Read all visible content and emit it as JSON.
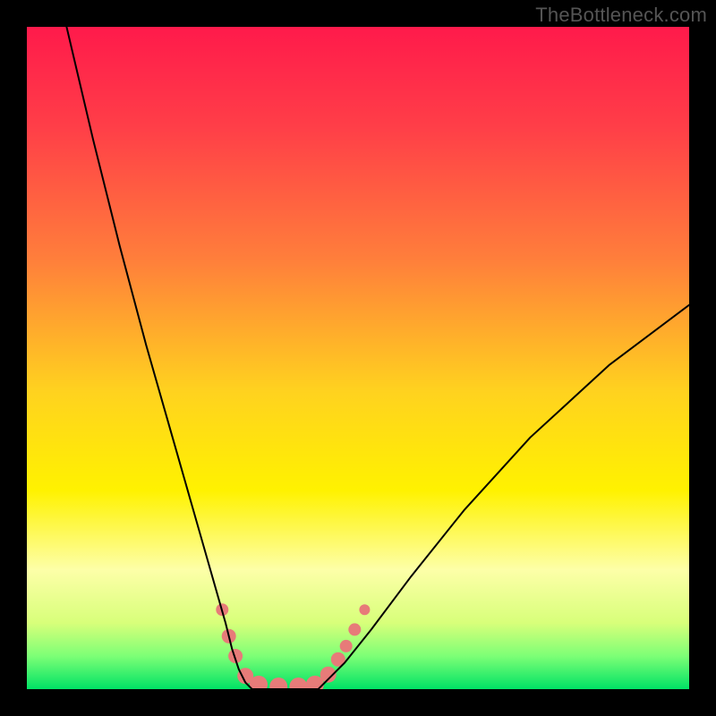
{
  "watermark": "TheBottleneck.com",
  "chart_data": {
    "type": "line",
    "title": "",
    "xlabel": "",
    "ylabel": "",
    "xlim": [
      0,
      100
    ],
    "ylim": [
      0,
      100
    ],
    "gradient_stops": [
      {
        "pct": 0,
        "color": "#ff1a4b"
      },
      {
        "pct": 15,
        "color": "#ff3e48"
      },
      {
        "pct": 35,
        "color": "#ff7e3b"
      },
      {
        "pct": 55,
        "color": "#ffd21f"
      },
      {
        "pct": 70,
        "color": "#fff200"
      },
      {
        "pct": 82,
        "color": "#fdffa8"
      },
      {
        "pct": 90,
        "color": "#d8ff7a"
      },
      {
        "pct": 95,
        "color": "#7dff76"
      },
      {
        "pct": 100,
        "color": "#00e265"
      }
    ],
    "series": [
      {
        "name": "left-curve",
        "x": [
          6,
          10,
          14,
          18,
          22,
          26,
          28,
          30,
          31,
          32,
          33,
          34
        ],
        "y": [
          100,
          83,
          67,
          52,
          38,
          24,
          17,
          10,
          6,
          3,
          1,
          0
        ]
      },
      {
        "name": "floor",
        "x": [
          34,
          40,
          44
        ],
        "y": [
          0,
          0,
          0
        ]
      },
      {
        "name": "right-curve",
        "x": [
          44,
          46,
          48,
          52,
          58,
          66,
          76,
          88,
          100
        ],
        "y": [
          0,
          2,
          4,
          9,
          17,
          27,
          38,
          49,
          58
        ]
      }
    ],
    "markers": {
      "name": "highlight-points",
      "color": "#e77b79",
      "points": [
        {
          "x": 29.5,
          "y": 12,
          "r": 7
        },
        {
          "x": 30.5,
          "y": 8,
          "r": 8
        },
        {
          "x": 31.5,
          "y": 5,
          "r": 8
        },
        {
          "x": 33,
          "y": 2,
          "r": 9
        },
        {
          "x": 35,
          "y": 0.7,
          "r": 10
        },
        {
          "x": 38,
          "y": 0.4,
          "r": 10
        },
        {
          "x": 41,
          "y": 0.4,
          "r": 10
        },
        {
          "x": 43.5,
          "y": 0.7,
          "r": 10
        },
        {
          "x": 45.5,
          "y": 2.2,
          "r": 9
        },
        {
          "x": 47,
          "y": 4.5,
          "r": 8
        },
        {
          "x": 48.2,
          "y": 6.5,
          "r": 7
        },
        {
          "x": 49.5,
          "y": 9,
          "r": 7
        },
        {
          "x": 51,
          "y": 12,
          "r": 6
        }
      ]
    }
  }
}
